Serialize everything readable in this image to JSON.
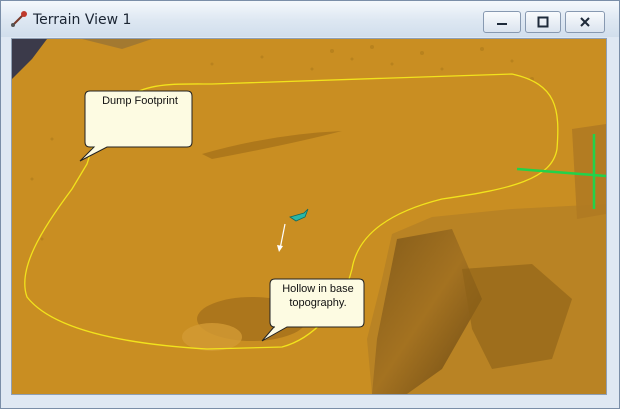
{
  "window": {
    "title": "Terrain View 1",
    "controls": [
      "minimize-icon",
      "maximize-icon",
      "close-icon"
    ]
  },
  "terrain": {
    "ground_color": "#c98e22",
    "footprint_color": "#f2e31c",
    "marker_color": "#22d24a",
    "callouts": {
      "dump_footprint": "Dump Footprint",
      "hollow": "Hollow in base topography."
    }
  }
}
